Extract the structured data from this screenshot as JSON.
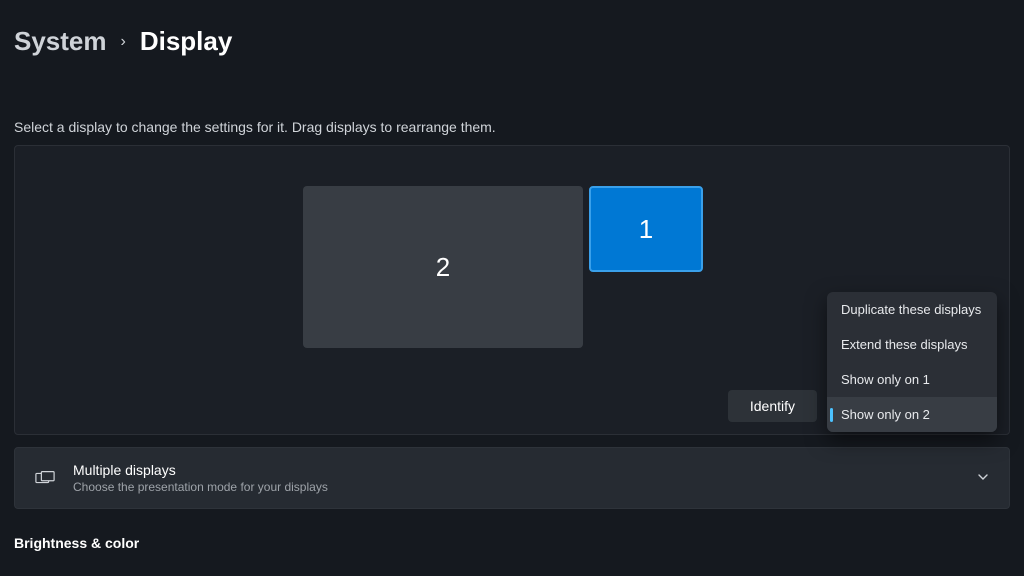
{
  "breadcrumb": {
    "parent": "System",
    "current": "Display"
  },
  "instruction": "Select a display to change the settings for it. Drag displays to rearrange them.",
  "monitors": {
    "primary": "1",
    "secondary": "2"
  },
  "identify_label": "Identify",
  "display_mode_menu": {
    "options": [
      "Duplicate these displays",
      "Extend these displays",
      "Show only on 1",
      "Show only on 2"
    ],
    "selected_index": 3
  },
  "multiple_displays": {
    "title": "Multiple displays",
    "subtitle": "Choose the presentation mode for your displays"
  },
  "section_header": "Brightness & color"
}
